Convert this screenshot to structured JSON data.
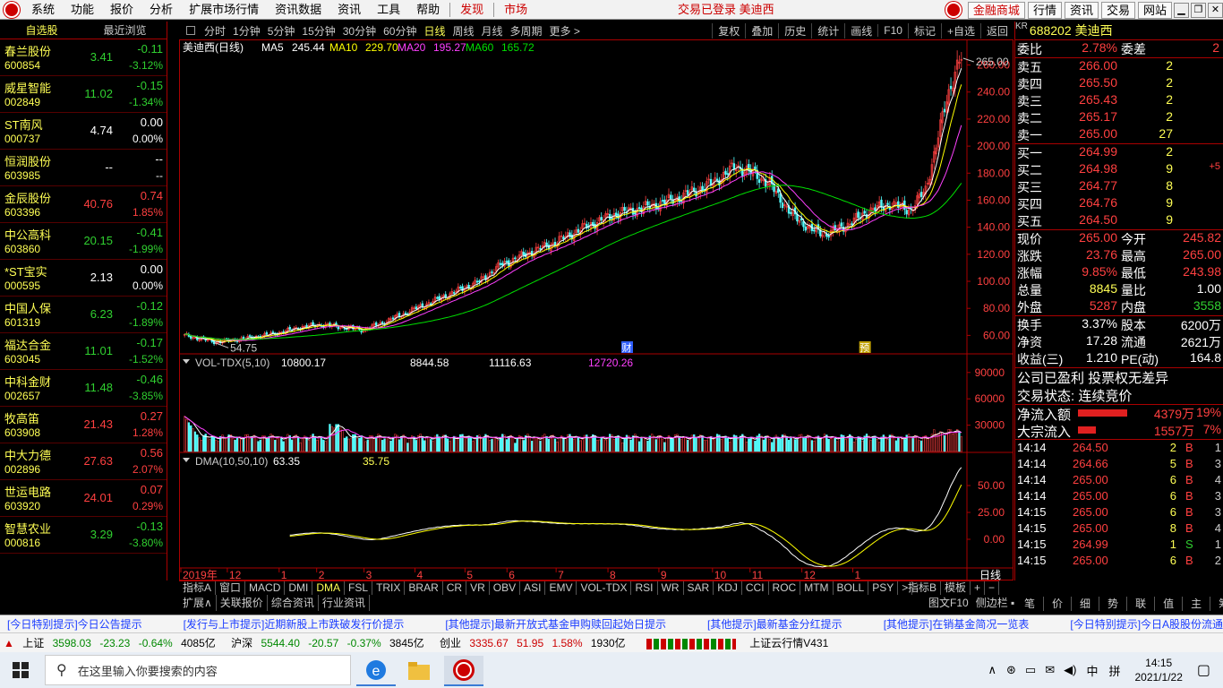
{
  "menubar": {
    "items": [
      "系统",
      "功能",
      "报价",
      "分析",
      "扩展市场行情",
      "资讯数据",
      "资讯",
      "工具",
      "帮助"
    ],
    "discover": "发现",
    "market": "市场",
    "status": "交易已登录  美迪西",
    "right_buttons": [
      "金融商城",
      "行情",
      "资讯",
      "交易",
      "网站"
    ]
  },
  "left_panel": {
    "tabs": [
      "自选股",
      "最近浏览"
    ],
    "stocks": [
      {
        "name": "春兰股份",
        "code": "600854",
        "price": "3.41",
        "change": "-0.11",
        "pct": "-3.12%",
        "dir": "dn"
      },
      {
        "name": "威星智能",
        "code": "002849",
        "price": "11.02",
        "change": "-0.15",
        "pct": "-1.34%",
        "dir": "dn"
      },
      {
        "name": "ST南风",
        "code": "000737",
        "price": "4.74",
        "change": "0.00",
        "pct": "0.00%",
        "dir": "wh"
      },
      {
        "name": "恒润股份",
        "code": "603985",
        "price": "--",
        "change": "--",
        "pct": "--",
        "dir": "wh"
      },
      {
        "name": "金辰股份",
        "code": "603396",
        "price": "40.76",
        "change": "0.74",
        "pct": "1.85%",
        "dir": "up"
      },
      {
        "name": "中公高科",
        "code": "603860",
        "price": "20.15",
        "change": "-0.41",
        "pct": "-1.99%",
        "dir": "dn"
      },
      {
        "name": "*ST宝实",
        "code": "000595",
        "price": "2.13",
        "change": "0.00",
        "pct": "0.00%",
        "dir": "wh"
      },
      {
        "name": "中国人保",
        "code": "601319",
        "price": "6.23",
        "change": "-0.12",
        "pct": "-1.89%",
        "dir": "dn"
      },
      {
        "name": "福达合金",
        "code": "603045",
        "price": "11.01",
        "change": "-0.17",
        "pct": "-1.52%",
        "dir": "dn"
      },
      {
        "name": "中科金财",
        "code": "002657",
        "price": "11.48",
        "change": "-0.46",
        "pct": "-3.85%",
        "dir": "dn"
      },
      {
        "name": "牧高笛",
        "code": "603908",
        "price": "21.43",
        "change": "0.27",
        "pct": "1.28%",
        "dir": "up"
      },
      {
        "name": "中大力德",
        "code": "002896",
        "price": "27.63",
        "change": "0.56",
        "pct": "2.07%",
        "dir": "up"
      },
      {
        "name": "世运电路",
        "code": "603920",
        "price": "24.01",
        "change": "0.07",
        "pct": "0.29%",
        "dir": "up"
      },
      {
        "name": "智慧农业",
        "code": "000816",
        "price": "3.29",
        "change": "-0.13",
        "pct": "-3.80%",
        "dir": "dn"
      }
    ]
  },
  "chart_toolbar": {
    "periods": [
      "分时",
      "1分钟",
      "5分钟",
      "15分钟",
      "30分钟",
      "60分钟",
      "日线",
      "周线",
      "月线",
      "多周期",
      "更多 >"
    ],
    "active": "日线",
    "right": [
      "复权",
      "叠加",
      "历史",
      "统计",
      "画线",
      "F10",
      "标记",
      "+自选",
      "返回"
    ]
  },
  "chart_data": {
    "type": "line",
    "title": "美迪西(日线)",
    "ma": [
      {
        "name": "MA5",
        "value": "245.44",
        "color": "#ffffff"
      },
      {
        "name": "MA10",
        "value": "229.70",
        "color": "#ffff00"
      },
      {
        "name": "MA20",
        "value": "195.27",
        "color": "#ff40ff"
      },
      {
        "name": "MA60",
        "value": "165.72",
        "color": "#00e000"
      }
    ],
    "price_ticks": [
      "260.00",
      "240.00",
      "220.00",
      "200.00",
      "180.00",
      "160.00",
      "140.00",
      "120.00",
      "100.00",
      "80.00",
      "60.00"
    ],
    "ylim": [
      47,
      267
    ],
    "high_label": "265.00",
    "low_label": "54.75",
    "markers": [
      "财",
      "预"
    ],
    "x_ticks": [
      "2019年",
      "12",
      "1",
      "2",
      "3",
      "4",
      "5",
      "6",
      "7",
      "8",
      "9",
      "10",
      "11",
      "12",
      "1"
    ],
    "period_label": "日线",
    "close_anchors": [
      [
        0,
        60
      ],
      [
        15,
        55
      ],
      [
        30,
        58
      ],
      [
        45,
        62
      ],
      [
        55,
        66
      ],
      [
        65,
        68
      ],
      [
        75,
        66
      ],
      [
        85,
        64
      ],
      [
        95,
        70
      ],
      [
        110,
        80
      ],
      [
        125,
        90
      ],
      [
        140,
        100
      ],
      [
        150,
        112
      ],
      [
        165,
        122
      ],
      [
        175,
        128
      ],
      [
        190,
        140
      ],
      [
        205,
        150
      ],
      [
        220,
        155
      ],
      [
        235,
        162
      ],
      [
        250,
        172
      ],
      [
        262,
        185
      ],
      [
        270,
        180
      ],
      [
        278,
        172
      ],
      [
        288,
        150
      ],
      [
        298,
        138
      ],
      [
        305,
        135
      ],
      [
        315,
        142
      ],
      [
        325,
        152
      ],
      [
        335,
        157
      ],
      [
        345,
        153
      ],
      [
        352,
        168
      ],
      [
        357,
        200
      ],
      [
        362,
        235
      ],
      [
        366,
        255
      ],
      [
        369,
        265
      ]
    ],
    "volume": {
      "title": "VOL-TDX(5,10)",
      "vvol": "10800.17",
      "volume": "8844.58",
      "ma5": "11116.63",
      "ma10": "12720.26",
      "ticks": [
        "90000",
        "60000",
        "30000"
      ],
      "ylim": [
        0,
        100000
      ]
    },
    "dma": {
      "title": "DMA(10,50,10)",
      "dif": "63.35",
      "difma": "35.75",
      "ticks": [
        "50.00",
        "25.00",
        "0.00"
      ],
      "ylim": [
        -25,
        70
      ]
    }
  },
  "right_panel": {
    "code": "688202",
    "name": "美迪西",
    "tag": "KR",
    "weibi_label": "委比",
    "weibi": "2.78%",
    "weicha_label": "委差",
    "weicha": "2",
    "asks": [
      {
        "label": "卖五",
        "price": "266.00",
        "vol": "2"
      },
      {
        "label": "卖四",
        "price": "265.50",
        "vol": "2"
      },
      {
        "label": "卖三",
        "price": "265.43",
        "vol": "2"
      },
      {
        "label": "卖二",
        "price": "265.17",
        "vol": "2"
      },
      {
        "label": "卖一",
        "price": "265.00",
        "vol": "27"
      }
    ],
    "bids": [
      {
        "label": "买一",
        "price": "264.99",
        "vol": "2",
        "extra": ""
      },
      {
        "label": "买二",
        "price": "264.98",
        "vol": "9",
        "extra": "+5"
      },
      {
        "label": "买三",
        "price": "264.77",
        "vol": "8",
        "extra": ""
      },
      {
        "label": "买四",
        "price": "264.76",
        "vol": "9",
        "extra": ""
      },
      {
        "label": "买五",
        "price": "264.50",
        "vol": "9",
        "extra": ""
      }
    ],
    "quote": [
      {
        "l1": "现价",
        "v1": "265.00",
        "c1": "up",
        "l2": "今开",
        "v2": "245.82",
        "c2": "up"
      },
      {
        "l1": "涨跌",
        "v1": "23.76",
        "c1": "up",
        "l2": "最高",
        "v2": "265.00",
        "c2": "up"
      },
      {
        "l1": "涨幅",
        "v1": "9.85%",
        "c1": "up",
        "l2": "最低",
        "v2": "243.98",
        "c2": "up"
      },
      {
        "l1": "总量",
        "v1": "8845",
        "c1": "yl",
        "l2": "量比",
        "v2": "1.00",
        "c2": "wh"
      },
      {
        "l1": "外盘",
        "v1": "5287",
        "c1": "up",
        "l2": "内盘",
        "v2": "3558",
        "c2": "dn"
      }
    ],
    "fund": [
      {
        "l1": "换手",
        "v1": "3.37%",
        "l2": "股本",
        "v2": "6200万"
      },
      {
        "l1": "净资",
        "v1": "17.28",
        "l2": "流通",
        "v2": "2621万"
      },
      {
        "l1": "收益(三)",
        "v1": "1.210",
        "l2": "PE(动)",
        "v2": "164.8"
      }
    ],
    "note1": "公司已盈利 投票权无差异",
    "note2": "交易状态: 连续竞价",
    "flows": [
      {
        "label": "净流入额",
        "value": "4379万",
        "pct": "19%",
        "bar": 0.19
      },
      {
        "label": "大宗流入",
        "value": "1557万",
        "pct": "7%",
        "bar": 0.07
      }
    ],
    "ticks": [
      {
        "time": "14:14",
        "price": "264.50",
        "vol": "2",
        "bs": "B",
        "n": "1"
      },
      {
        "time": "14:14",
        "price": "264.66",
        "vol": "5",
        "bs": "B",
        "n": "3"
      },
      {
        "time": "14:14",
        "price": "265.00",
        "vol": "6",
        "bs": "B",
        "n": "4"
      },
      {
        "time": "14:14",
        "price": "265.00",
        "vol": "6",
        "bs": "B",
        "n": "3"
      },
      {
        "time": "14:15",
        "price": "265.00",
        "vol": "6",
        "bs": "B",
        "n": "3"
      },
      {
        "time": "14:15",
        "price": "265.00",
        "vol": "8",
        "bs": "B",
        "n": "4"
      },
      {
        "time": "14:15",
        "price": "264.99",
        "vol": "1",
        "bs": "S",
        "n": "1"
      },
      {
        "time": "14:15",
        "price": "265.00",
        "vol": "6",
        "bs": "B",
        "n": "2"
      }
    ],
    "buttons": [
      "笔",
      "价",
      "细",
      "势",
      "联",
      "值",
      "主",
      "筹"
    ]
  },
  "bottom_tabs": {
    "row1": [
      "指标A",
      "窗口",
      "MACD",
      "DMI",
      "DMA",
      "FSL",
      "TRIX",
      "BRAR",
      "CR",
      "VR",
      "OBV",
      "ASI",
      "EMV",
      "VOL-TDX",
      "RSI",
      "WR",
      "SAR",
      "KDJ",
      "CCI",
      "ROC",
      "MTM",
      "BOLL",
      "PSY",
      ">"
    ],
    "row1_right": [
      "指标B",
      "模板",
      "+",
      "−"
    ],
    "row2": [
      "扩展∧",
      "关联报价",
      "综合资讯",
      "行业资讯"
    ],
    "row2_right": [
      "图文F10",
      "侧边栏 ▪"
    ]
  },
  "ticker": [
    "[今日特别提示]今日公告提示",
    "[发行与上市提示]近期新股上市跌破发行价提示",
    "[其他提示]最新开放式基金申购赎回起始日提示",
    "[其他提示]最新基金分红提示",
    "[其他提示]在销基金简况一览表",
    "[今日特别提示]今日A股股份流通"
  ],
  "status": {
    "sh_name": "上证",
    "sh_val": "3598.03",
    "sh_chg": "-23.23",
    "sh_pct": "-0.64%",
    "sh_amt": "4085亿",
    "sz_name": "沪深",
    "sz_val": "5544.40",
    "sz_chg": "-20.57",
    "sz_pct": "-0.37%",
    "sz_amt": "3845亿",
    "cy_name": "创业",
    "cy_val": "3335.67",
    "cy_chg": "51.95",
    "cy_pct": "1.58%",
    "cy_amt": "1930亿",
    "version": "上证云行情V431"
  },
  "taskbar": {
    "search_placeholder": "在这里输入你要搜索的内容",
    "time": "14:15",
    "date": "2021/1/22",
    "ime": "中",
    "ime2": "拼"
  }
}
